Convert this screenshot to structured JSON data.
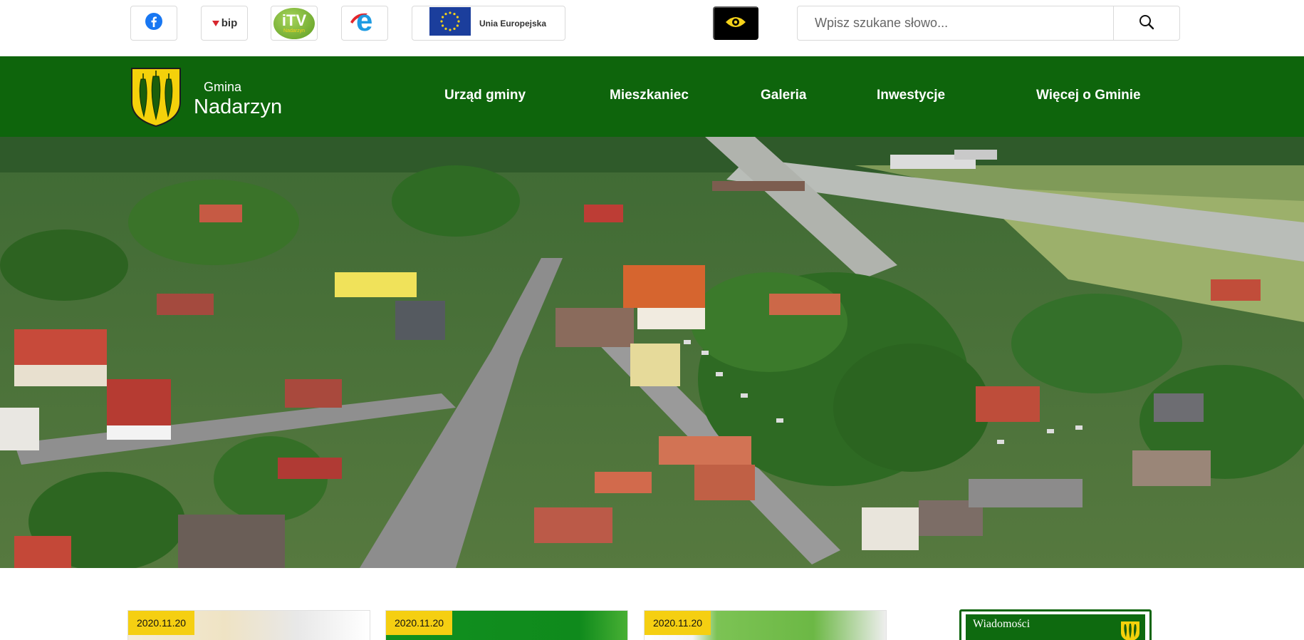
{
  "topbar": {
    "facebook_icon": "facebook-icon",
    "bip_label": "bip",
    "itv_label": "TV",
    "itv_prefix": "i",
    "itv_sub": "Nadarzyn",
    "e_label": "e",
    "eu_label": "Unia Europejska",
    "contrast_icon": "eye-icon",
    "search": {
      "placeholder": "Wpisz szukane słowo...",
      "value": "",
      "icon": "search-icon"
    }
  },
  "header": {
    "logo_small": "Gmina",
    "logo_big": "Nadarzyn",
    "nav": [
      {
        "label": "Urząd gminy"
      },
      {
        "label": "Mieszkaniec"
      },
      {
        "label": "Galeria"
      },
      {
        "label": "Inwestycje"
      },
      {
        "label": "Więcej o Gminie"
      }
    ]
  },
  "news": [
    {
      "date": "2020.11.20"
    },
    {
      "date": "2020.11.20"
    },
    {
      "date": "2020.11.20"
    }
  ],
  "promo": {
    "label": "Wiadomości"
  },
  "colors": {
    "brand_green": "#0e650c",
    "accent_yellow": "#f5cf12",
    "logo_yellow": "#f4d10b"
  }
}
